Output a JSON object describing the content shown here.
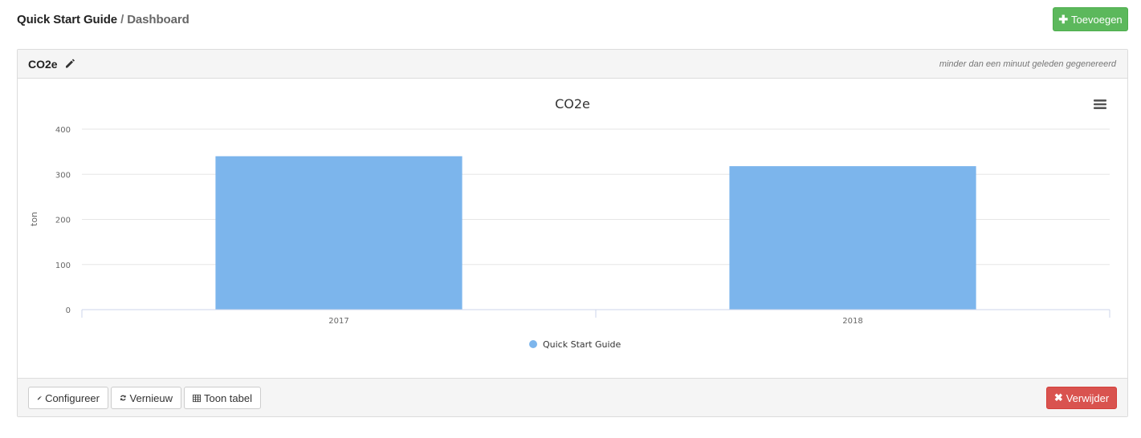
{
  "breadcrumb": {
    "root": "Quick Start Guide",
    "separator": " / ",
    "current": "Dashboard"
  },
  "actions": {
    "add_label": "Toevoegen",
    "add_icon": "plus-icon"
  },
  "widget": {
    "title": "CO2e",
    "edit_icon": "pencil-icon",
    "generated_text": "minder dan een minuut geleden gegenereerd",
    "menu_icon": "hamburger-icon"
  },
  "footer": {
    "configure_label": "Configureer",
    "refresh_label": "Vernieuw",
    "table_label": "Toon tabel",
    "delete_label": "Verwijder"
  },
  "colors": {
    "add_button": "#5cb85c",
    "delete_button": "#d9534f",
    "bar": "#7cb5ec"
  },
  "chart_data": {
    "type": "bar",
    "title": "CO2e",
    "xlabel": "",
    "ylabel": "ton",
    "categories": [
      "2017",
      "2018"
    ],
    "series": [
      {
        "name": "Quick Start Guide",
        "values": [
          340,
          318
        ]
      }
    ],
    "ylim": [
      0,
      400
    ],
    "yticks": [
      0,
      100,
      200,
      300,
      400
    ],
    "grid": true,
    "legend_position": "bottom-center"
  }
}
